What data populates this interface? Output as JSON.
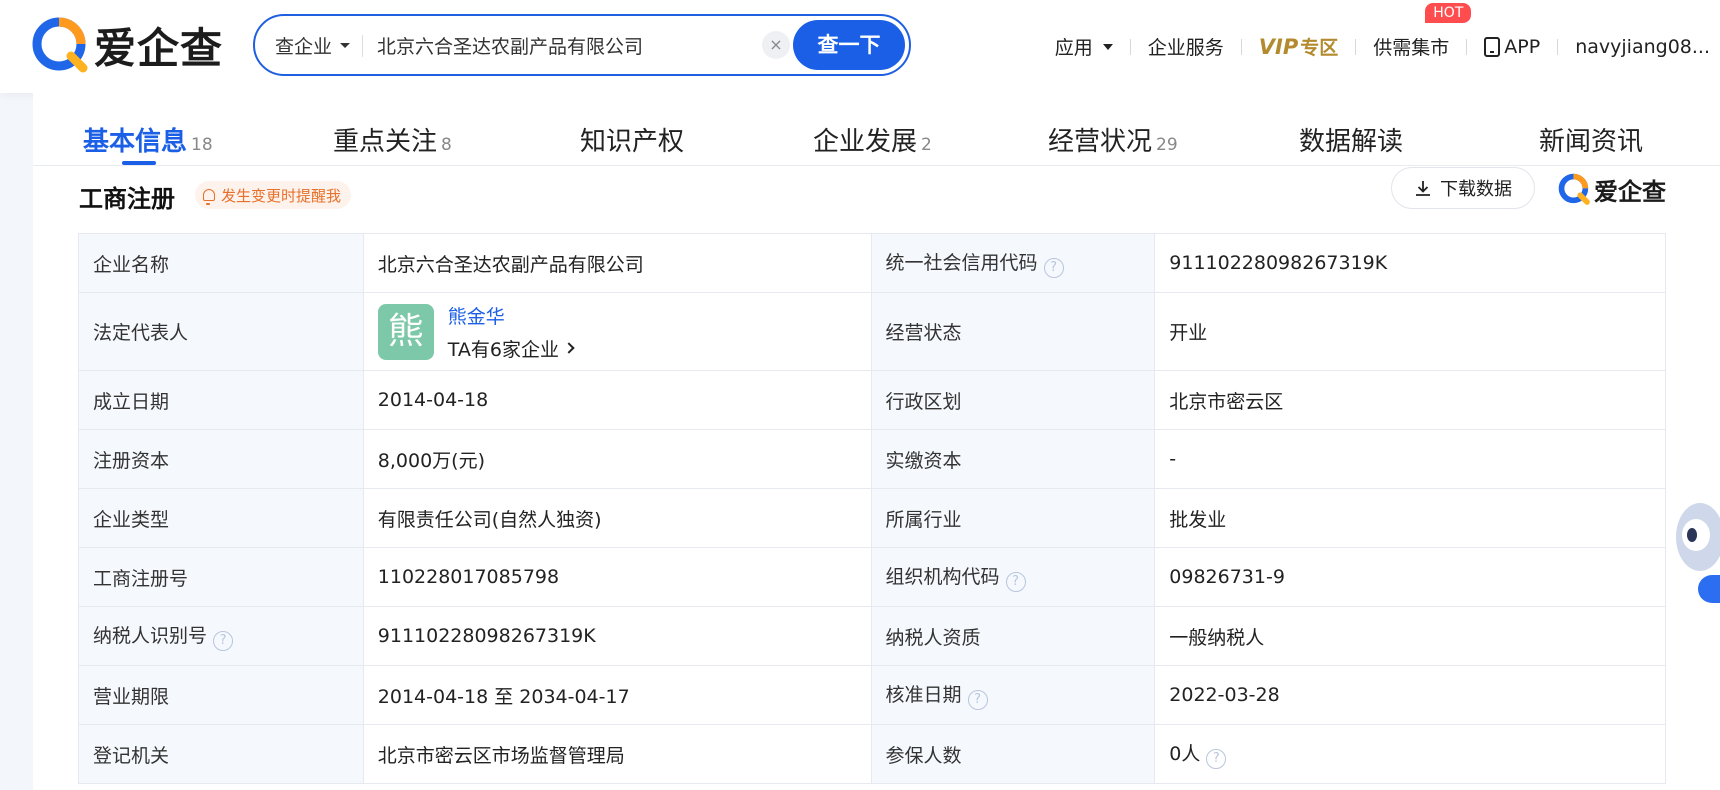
{
  "header": {
    "logo_text": "爱企查",
    "search": {
      "type_label": "查企业",
      "value": "北京六合圣达农副产品有限公司",
      "clear": "×",
      "button": "查一下"
    },
    "nav": {
      "apps": "应用",
      "enterprise_services": "企业服务",
      "vip": "VIP",
      "vip_zone": "专区",
      "market": "供需集市",
      "hot_badge": "HOT",
      "app": "APP",
      "user": "navyjiang08..."
    }
  },
  "tabs": [
    {
      "label": "基本信息",
      "count": "18"
    },
    {
      "label": "重点关注",
      "count": "8"
    },
    {
      "label": "知识产权",
      "count": ""
    },
    {
      "label": "企业发展",
      "count": "2"
    },
    {
      "label": "经营状况",
      "count": "29"
    },
    {
      "label": "数据解读",
      "count": ""
    },
    {
      "label": "新闻资讯",
      "count": ""
    }
  ],
  "section": {
    "title": "工商注册",
    "remind": "发生变更时提醒我",
    "download": "下载数据",
    "brand": "爱企查"
  },
  "registration": {
    "company_name_label": "企业名称",
    "company_name": "北京六合圣达农副产品有限公司",
    "credit_code_label": "统一社会信用代码",
    "credit_code": "91110228098267319K",
    "legal_rep_label": "法定代表人",
    "legal_rep_avatar": "熊",
    "legal_rep_name": "熊金华",
    "legal_rep_companies": "TA有6家企业",
    "status_label": "经营状态",
    "status": "开业",
    "founded_label": "成立日期",
    "founded": "2014-04-18",
    "region_label": "行政区划",
    "region": "北京市密云区",
    "capital_label": "注册资本",
    "capital": "8,000万(元)",
    "paid_capital_label": "实缴资本",
    "paid_capital": "-",
    "type_label": "企业类型",
    "type": "有限责任公司(自然人独资)",
    "industry_label": "所属行业",
    "industry": "批发业",
    "reg_no_label": "工商注册号",
    "reg_no": "110228017085798",
    "org_code_label": "组织机构代码",
    "org_code": "09826731-9",
    "taxpayer_id_label": "纳税人识别号",
    "taxpayer_id": "91110228098267319K",
    "taxpayer_qual_label": "纳税人资质",
    "taxpayer_qual": "一般纳税人",
    "term_label": "营业期限",
    "term": "2014-04-18 至 2034-04-17",
    "approval_label": "核准日期",
    "approval": "2022-03-28",
    "authority_label": "登记机关",
    "authority": "北京市密云区市场监督管理局",
    "insured_label": "参保人数",
    "insured": "0人"
  }
}
